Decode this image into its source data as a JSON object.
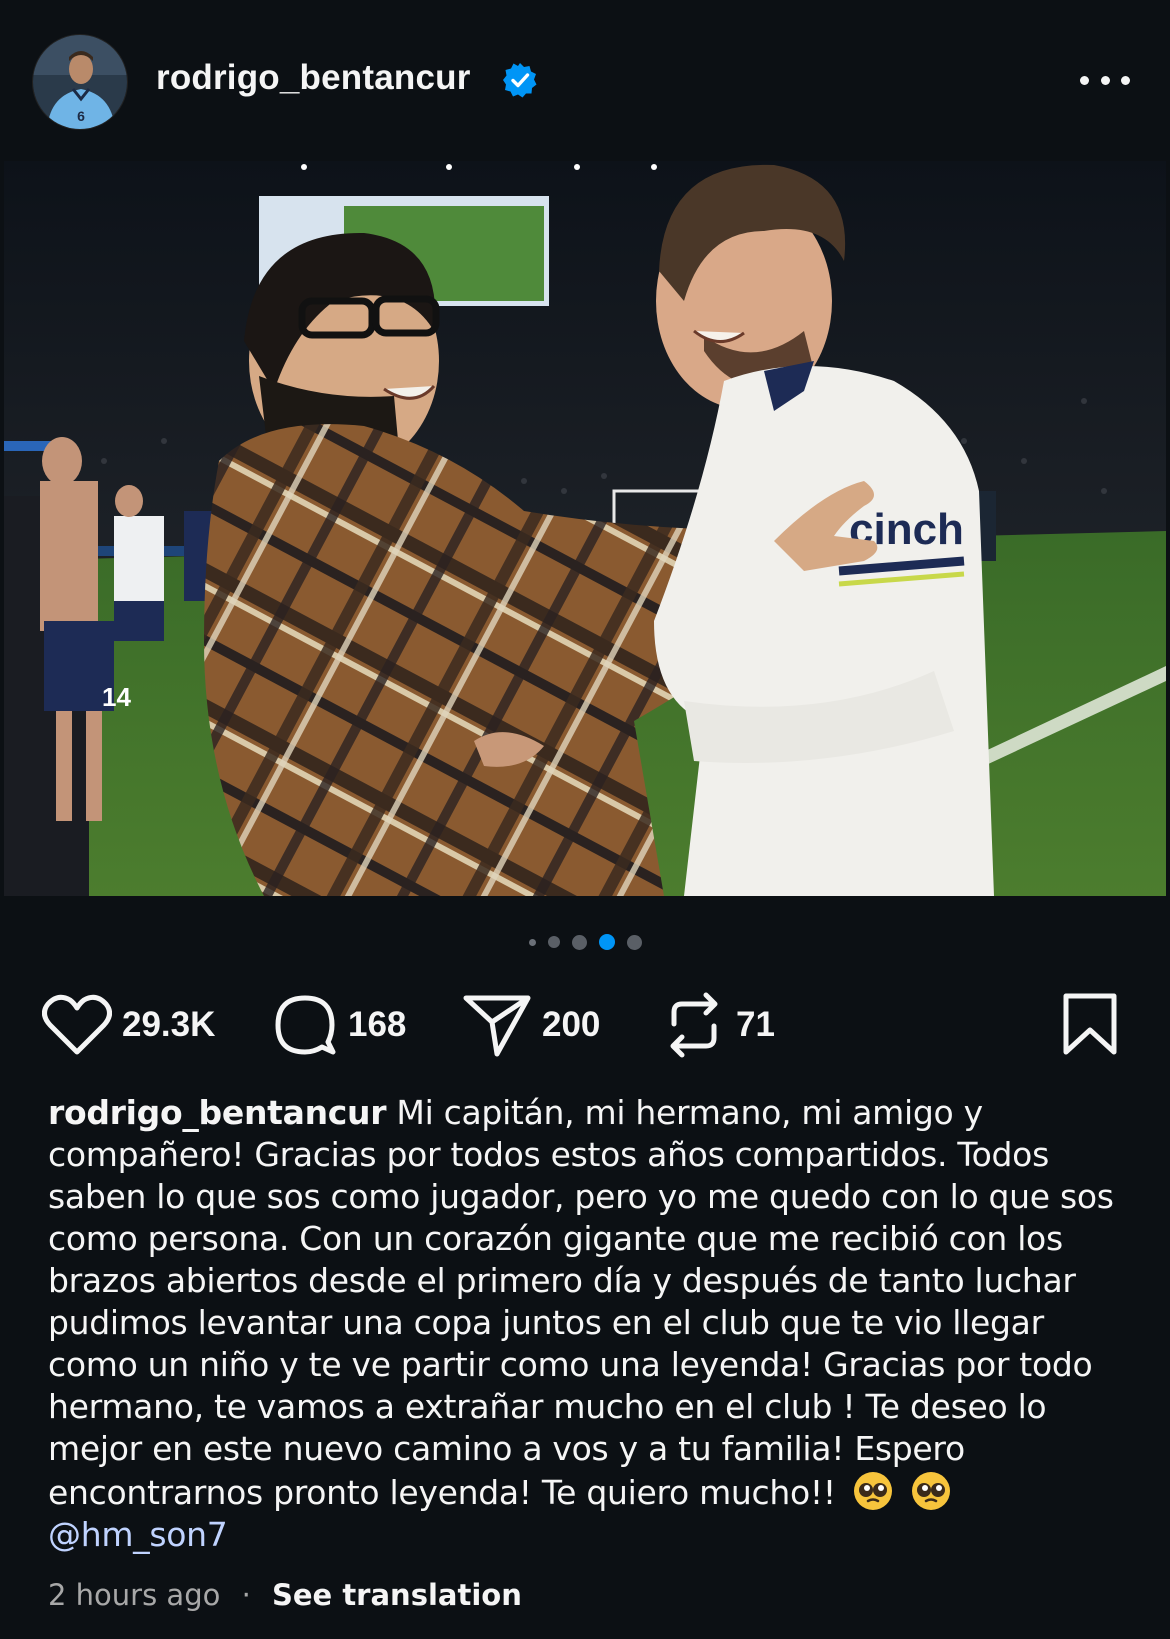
{
  "post": {
    "username": "rodrigo_bentancur",
    "avatar_jersey_number": "6",
    "verified_icon": "verified-badge-icon",
    "accent_color": "#0095f6"
  },
  "carousel": {
    "dot_count": 5,
    "active_index": 3,
    "sponsor_text": "cinch",
    "shorts_number": "14"
  },
  "actions": {
    "likes": "29.3K",
    "comments": "168",
    "shares": "200",
    "reposts": "71"
  },
  "caption": {
    "username": "rodrigo_bentancur",
    "text": "Mi capitán, mi hermano, mi amigo y compañero! Gracias por todos estos años compartidos. Todos saben lo que sos como jugador, pero yo me quedo con lo que sos como persona. Con un corazón gigante que me recibió con los brazos abiertos desde el primero día y después de tanto luchar pudimos levantar una copa juntos en el club que te vio llegar como un niño y te ve partir como una leyenda! Gracias por todo hermano, te vamos a extrañar mucho en el club ! Te deseo lo mejor en este nuevo camino a vos y a tu familia! Espero encontrarnos pronto leyenda! Te quiero mucho!!",
    "emojis": [
      "pleading-face-icon",
      "pleading-face-icon"
    ],
    "mention": "@hm_son7"
  },
  "meta": {
    "time": "2 hours ago",
    "separator": "·",
    "translate": "See translation"
  }
}
